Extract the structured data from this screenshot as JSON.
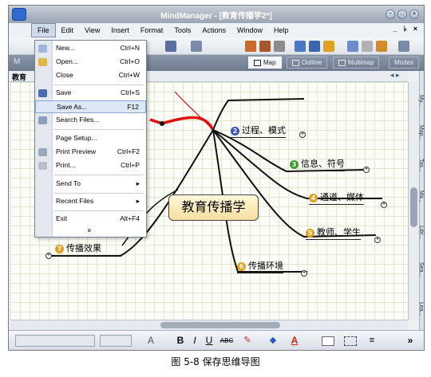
{
  "window": {
    "title": "MindManager - [教育传播学2*]"
  },
  "menubar": {
    "items": [
      "File",
      "Edit",
      "View",
      "Insert",
      "Format",
      "Tools",
      "Actions",
      "Window",
      "Help"
    ],
    "right_controls": [
      "_",
      "♭",
      "×"
    ]
  },
  "viewbar": {
    "doc_label": "M",
    "tabs": [
      "Map",
      "Outline",
      "Multimap",
      "Modes"
    ]
  },
  "doc_tab": "教育",
  "file_menu": {
    "items": [
      {
        "label": "New...",
        "shortcut": "Ctrl+N"
      },
      {
        "label": "Open...",
        "shortcut": "Ctrl+O"
      },
      {
        "label": "Close",
        "shortcut": "Ctrl+W"
      },
      {
        "label": "Save",
        "shortcut": "Ctrl+S"
      },
      {
        "label": "Save As...",
        "shortcut": "F12"
      },
      {
        "label": "Search Files...",
        "shortcut": ""
      },
      {
        "label": "Page Setup...",
        "shortcut": ""
      },
      {
        "label": "Print Preview",
        "shortcut": "Ctrl+F2"
      },
      {
        "label": "Print...",
        "shortcut": "Ctrl+P"
      },
      {
        "label": "Send To",
        "shortcut": "▸"
      },
      {
        "label": "Recent Files",
        "shortcut": "▸"
      },
      {
        "label": "Exit",
        "shortcut": "Alt+F4"
      }
    ],
    "expand_glyph": "»"
  },
  "mindmap": {
    "central": "教育传播学",
    "topics": [
      {
        "num": "2",
        "label": "过程、模式",
        "color": "#3a55b8"
      },
      {
        "num": "3",
        "label": "信息、符号",
        "color": "#3d9a2e"
      },
      {
        "num": "4",
        "label": "通道、媒体",
        "color": "#e0a020"
      },
      {
        "num": "5",
        "label": "教师、学生",
        "color": "#e0a020"
      },
      {
        "num": "6",
        "label": "传播环境",
        "color": "#e0a020"
      },
      {
        "num": "7",
        "label": "传播效果",
        "color": "#e0a020"
      }
    ],
    "plus_glyph": "+"
  },
  "side_panel": {
    "items": [
      "My...",
      "Map...",
      "Tas...",
      "Ma...",
      "Libr...",
      "Sea...",
      "Lea..."
    ]
  },
  "bottom_toolbar": {
    "bold": "B",
    "italic": "I",
    "underline": "U",
    "strike": "ABC",
    "more": "»"
  },
  "caption": "图 5-8  保存思维导图",
  "colors": {
    "central_fill": "#f5dea0",
    "branch": "#111111",
    "red_branch": "#e01010"
  }
}
